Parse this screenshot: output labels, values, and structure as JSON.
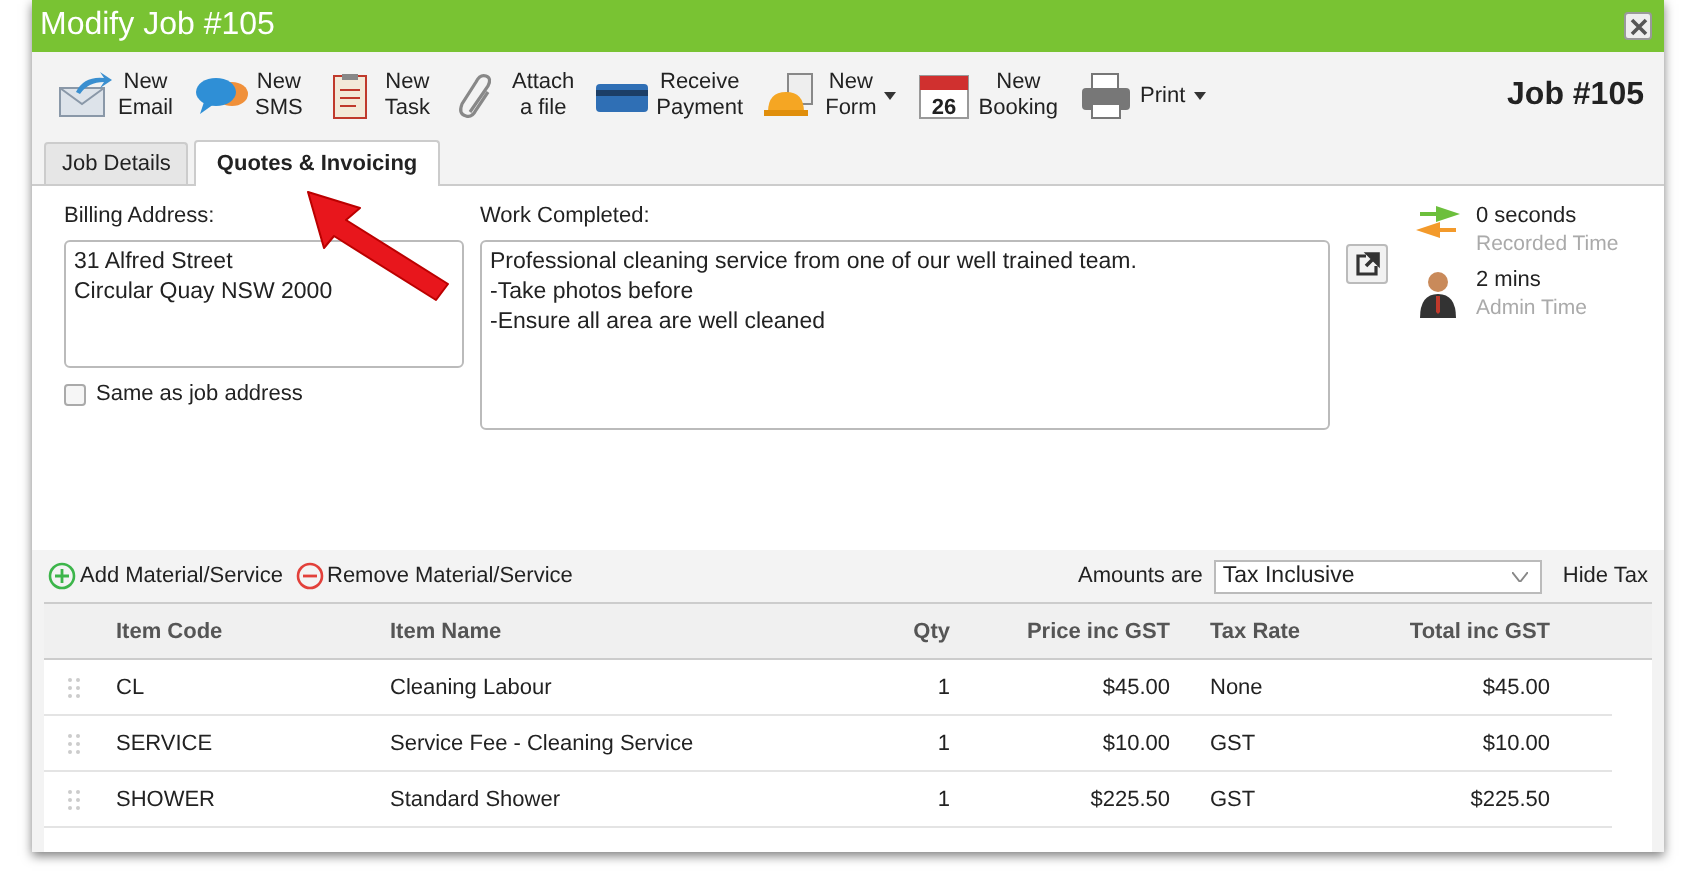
{
  "window": {
    "title": "Modify Job #105",
    "job_heading": "Job #105"
  },
  "toolbar": [
    {
      "lines": [
        "New",
        "Email"
      ],
      "dropdown": false
    },
    {
      "lines": [
        "New",
        "SMS"
      ],
      "dropdown": false
    },
    {
      "lines": [
        "New",
        "Task"
      ],
      "dropdown": false
    },
    {
      "lines": [
        "Attach",
        "a file"
      ],
      "dropdown": false
    },
    {
      "lines": [
        "Receive",
        "Payment"
      ],
      "dropdown": false
    },
    {
      "lines": [
        "New",
        "Form"
      ],
      "dropdown": true
    },
    {
      "lines": [
        "New",
        "Booking"
      ],
      "dropdown": false,
      "calendar_day": "26"
    },
    {
      "lines": [
        "Print"
      ],
      "dropdown": true
    }
  ],
  "tabs": [
    {
      "label": "Job Details",
      "selected": false
    },
    {
      "label": "Quotes & Invoicing",
      "selected": true
    }
  ],
  "billing": {
    "label": "Billing Address:",
    "value": [
      "31 Alfred Street",
      "Circular Quay NSW 2000"
    ],
    "same_as_job": {
      "label": "Same as job address",
      "checked": false
    }
  },
  "work": {
    "label": "Work Completed:",
    "value": [
      "Professional cleaning service from one of our well trained team.",
      "-Take photos before",
      "-Ensure all area are well cleaned"
    ]
  },
  "times": [
    {
      "value": "0 seconds",
      "caption": "Recorded Time"
    },
    {
      "value": "2 mins",
      "caption": "Admin Time"
    }
  ],
  "materials_bar": {
    "add": "Add Material/Service",
    "remove": "Remove Material/Service",
    "amounts_label": "Amounts are",
    "amounts_value": "Tax Inclusive",
    "hide_tax": "Hide Tax"
  },
  "table": {
    "columns": [
      "Item Code",
      "Item Name",
      "Qty",
      "Price inc GST",
      "Tax Rate",
      "Total inc GST"
    ],
    "rows": [
      [
        "CL",
        "Cleaning Labour",
        "1",
        "$45.00",
        "None",
        "$45.00"
      ],
      [
        "SERVICE",
        "Service Fee - Cleaning Service",
        "1",
        "$10.00",
        "GST",
        "$10.00"
      ],
      [
        "SHOWER",
        "Standard Shower",
        "1",
        "$225.50",
        "GST",
        "$225.50"
      ]
    ]
  }
}
